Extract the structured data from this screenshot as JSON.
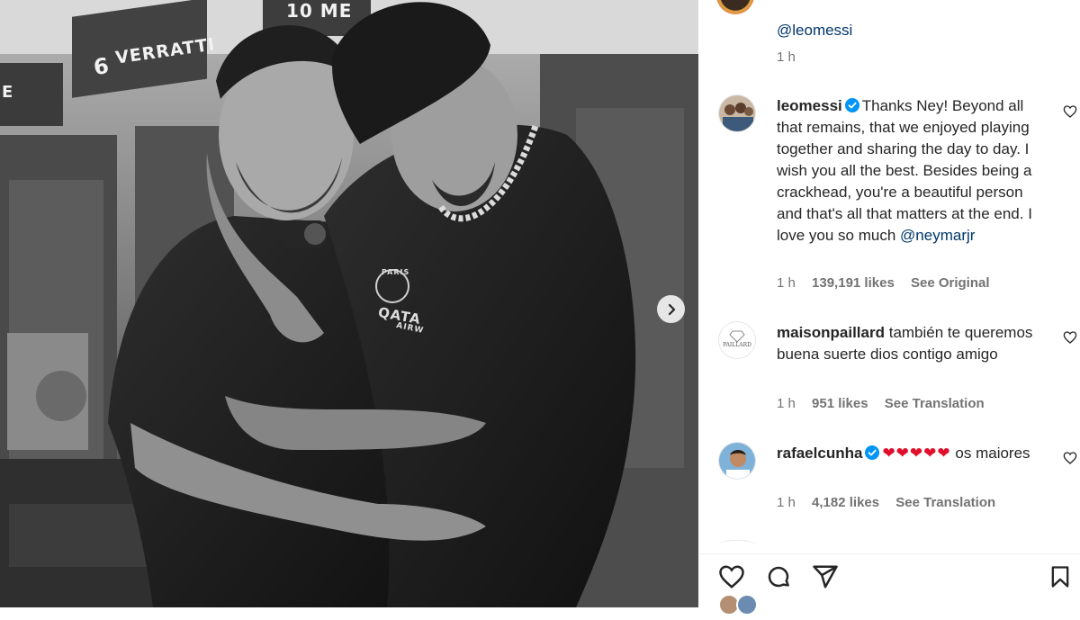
{
  "photo": {
    "locker_number": "6",
    "locker_name": "VERRATTI",
    "locker_partial": "E",
    "locker_top": "10 ME",
    "shirt_text_1": "PARIS",
    "shirt_text_2": "QATA",
    "shirt_text_3": "AIRW"
  },
  "top_caption": {
    "mention": "@leomessi",
    "time": "1 h"
  },
  "comments": [
    {
      "username": "leomessi",
      "verified": true,
      "text": "Thanks Ney! Beyond all that remains, that we enjoyed playing together and sharing the day to day. I wish you all the best. Besides being a crackhead, you're a beautiful person and that's all that matters at the end. I love you so much",
      "mention": "@neymarjr",
      "time": "1 h",
      "likes": "139,191 likes",
      "action": "See Original"
    },
    {
      "username": "maisonpaillard",
      "verified": false,
      "text": "también te queremos",
      "text2": "buena suerte dios contigo amigo",
      "avatar_text": "PAILLARD",
      "time": "1 h",
      "likes": "951 likes",
      "action": "See Translation"
    },
    {
      "username": "rafaelcunha",
      "verified": true,
      "emoji": "❤❤❤❤❤",
      "text": "os maiores",
      "time": "1 h",
      "likes": "4,182 likes",
      "action": "See Translation"
    }
  ],
  "actions": {
    "like_icon": "heart-icon",
    "comment_icon": "comment-icon",
    "share_icon": "share-icon",
    "save_icon": "bookmark-icon"
  },
  "colors": {
    "link": "#00376b",
    "verified": "#0095f6",
    "heart": "#e0102d",
    "meta": "#737373"
  }
}
